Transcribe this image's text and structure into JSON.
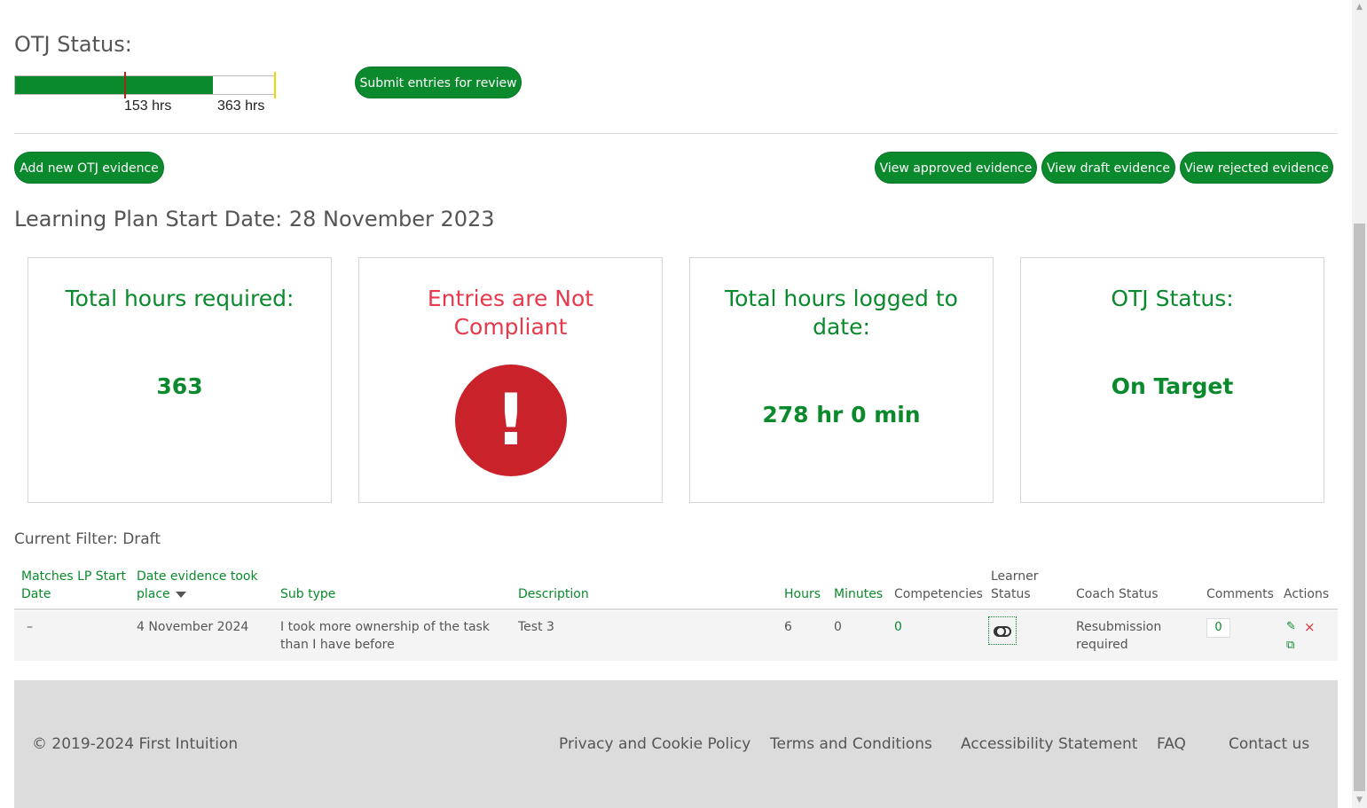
{
  "otj": {
    "title": "OTJ Status:",
    "progress_fraction": 0.765,
    "target_marker_fraction": 0.42,
    "hours_label_logged": "153 hrs",
    "hours_label_required": "363 hrs",
    "submit_label": "Submit entries for review"
  },
  "toolbar": {
    "add_label": "Add new OTJ evidence",
    "approved_label": "View approved evidence",
    "draft_label": "View draft evidence",
    "rejected_label": "View rejected evidence"
  },
  "learning_plan": {
    "start_date_text": "Learning Plan Start Date: 28 November 2023"
  },
  "cards": {
    "required": {
      "title": "Total hours required:",
      "value": "363"
    },
    "compliance": {
      "title": "Entries are Not Compliant",
      "icon": "exclamation-circle-icon",
      "icon_glyph": "!"
    },
    "logged": {
      "title": "Total hours logged to date:",
      "value": "278 hr 0 min"
    },
    "status": {
      "title": "OTJ Status:",
      "value": "On Target"
    }
  },
  "filter": {
    "label": "Current Filter: Draft"
  },
  "table": {
    "headers": {
      "matches": "Matches LP Start Date",
      "date": "Date evidence took place",
      "subtype": "Sub type",
      "description": "Description",
      "hours": "Hours",
      "minutes": "Minutes",
      "competencies": "Competencies",
      "learner_status": "Learner Status",
      "coach_status": "Coach Status",
      "comments": "Comments",
      "actions": "Actions"
    },
    "rows": [
      {
        "matches": "–",
        "date": "4 November 2024",
        "subtype": "I took more ownership of the task than I have before",
        "description": "Test 3",
        "hours": "6",
        "minutes": "0",
        "competencies": "0",
        "coach_status": "Resubmission required",
        "comments": "0",
        "edit_glyph": "✎",
        "delete_glyph": "×",
        "copy_glyph": "⧉"
      }
    ]
  },
  "footer": {
    "copyright": "© 2019-2024 First Intuition",
    "links": [
      "Privacy and Cookie Policy",
      "Terms and Conditions",
      "Accessibility Statement",
      "FAQ",
      "Contact us"
    ]
  },
  "colors": {
    "brand_green": "#0a8a2c",
    "alert_red": "#c9222b",
    "alert_text_red": "#e8394c",
    "marker_yellow": "#f2d600"
  },
  "scrollbar": {
    "up_glyph": "▲",
    "down_glyph": "▼"
  }
}
